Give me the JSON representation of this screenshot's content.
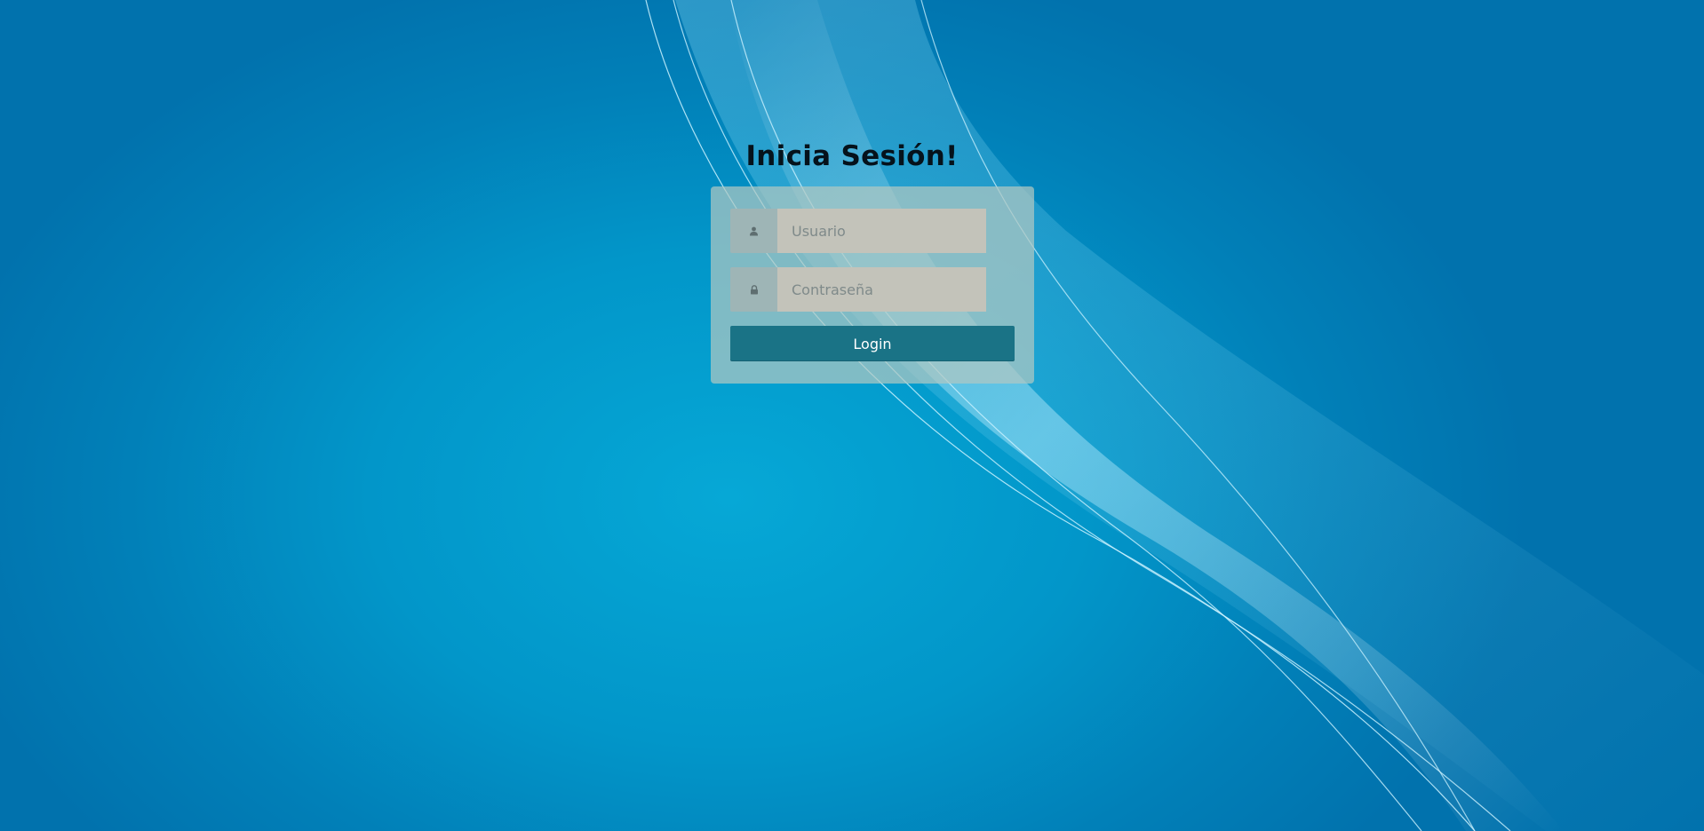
{
  "login": {
    "title": "Inicia Sesión!",
    "username_placeholder": "Usuario",
    "password_placeholder": "Contraseña",
    "submit_label": "Login"
  },
  "icons": {
    "username": "user-icon",
    "password": "lock-icon"
  },
  "colors": {
    "background": "#0296c9",
    "panel": "#b0c7c2",
    "button": "#1a7386",
    "button_text": "#ffffff",
    "title_text": "#05121b"
  }
}
